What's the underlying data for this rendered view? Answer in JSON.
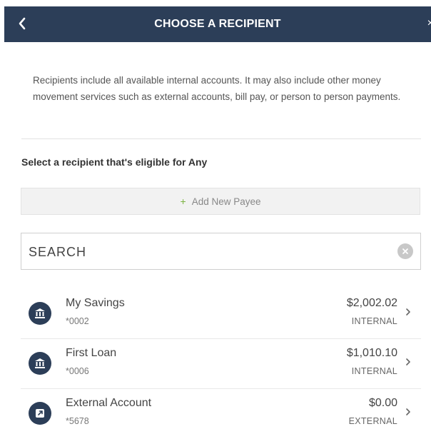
{
  "header": {
    "title": "CHOOSE A RECIPIENT"
  },
  "intro": {
    "text": "Recipients include all available internal accounts. It may also include other money movement services such as external accounts, bill pay, or person to person payments."
  },
  "section": {
    "label": "Select a recipient that's eligible for Any"
  },
  "add_payee": {
    "plus": "+",
    "label": "Add New Payee"
  },
  "search": {
    "placeholder": "SEARCH"
  },
  "recipients": [
    {
      "name": "My Savings",
      "account": "*0002",
      "amount": "$2,002.02",
      "type": "INTERNAL",
      "icon": "bank-icon"
    },
    {
      "name": "First Loan",
      "account": "*0006",
      "amount": "$1,010.10",
      "type": "INTERNAL",
      "icon": "bank-icon"
    },
    {
      "name": "External Account",
      "account": "*5678",
      "amount": "$0.00",
      "type": "EXTERNAL",
      "icon": "external-link-icon"
    }
  ],
  "colors": {
    "header": "#2c3e58",
    "accent": "#7cb342"
  }
}
